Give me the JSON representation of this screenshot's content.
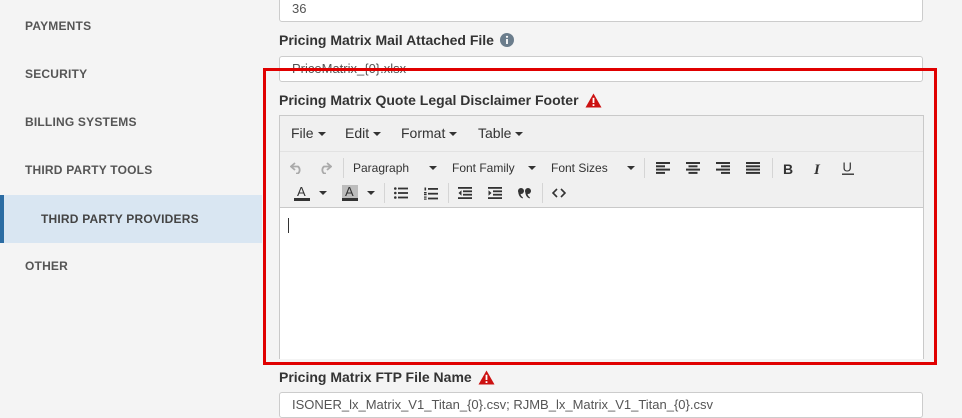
{
  "sidebar": {
    "items": [
      {
        "label": "PAYMENTS"
      },
      {
        "label": "SECURITY"
      },
      {
        "label": "BILLING SYSTEMS"
      },
      {
        "label": "THIRD PARTY TOOLS"
      },
      {
        "label": "THIRD PARTY PROVIDERS",
        "active": true
      },
      {
        "label": "OTHER"
      }
    ]
  },
  "fields": {
    "top_value": "36",
    "mail_attached": {
      "label": "Pricing Matrix Mail Attached File",
      "value": "PriceMatrix_{0}.xlsx",
      "icon": "info-circle-icon"
    },
    "disclaimer": {
      "label": "Pricing Matrix Quote Legal Disclaimer Footer",
      "icon": "warning-triangle-icon"
    },
    "ftp": {
      "label": "Pricing Matrix FTP File Name",
      "value": "ISONER_lx_Matrix_V1_Titan_{0}.csv; RJMB_lx_Matrix_V1_Titan_{0}.csv",
      "icon": "warning-triangle-icon"
    }
  },
  "editor": {
    "menus": [
      "File",
      "Edit",
      "Format",
      "Table"
    ],
    "paragraph_label": "Paragraph",
    "font_family_label": "Font Family",
    "font_sizes_label": "Font Sizes",
    "text_color_glyph": "A",
    "bg_color_glyph": "A",
    "content": ""
  },
  "colors": {
    "highlight": "#e00000",
    "warning": "#cc1111",
    "active_accent": "#2b6ca3",
    "active_bg": "#d9e6f2"
  }
}
